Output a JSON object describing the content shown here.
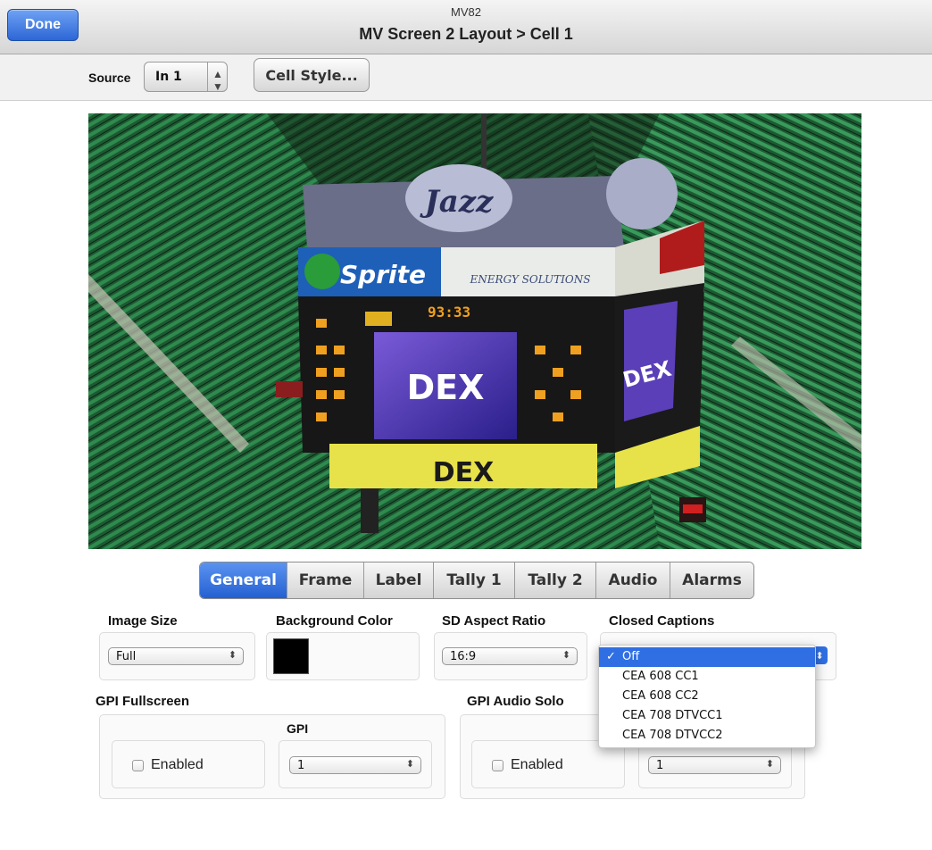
{
  "titlebar": {
    "done_label": "Done",
    "device": "MV82",
    "title": "MV Screen 2 Layout > Cell 1"
  },
  "sourcebar": {
    "source_label": "Source",
    "source_value": "In 1",
    "cell_style_label": "Cell Style..."
  },
  "preview": {
    "description_icon": "scoreboard-image",
    "signs": {
      "team": "Jazz",
      "sponsor": "Sprite",
      "sponsor2": "ENERGY SOLUTIONS",
      "screen": "DEX",
      "banner": "DEX",
      "side_screen": "DEX",
      "clock": "93:33"
    }
  },
  "tabs": [
    "General",
    "Frame",
    "Label",
    "Tally 1",
    "Tally 2",
    "Audio",
    "Alarms"
  ],
  "active_tab": "General",
  "general": {
    "image_size_label": "Image Size",
    "image_size_value": "Full",
    "background_color_label": "Background Color",
    "background_color": "#000000",
    "sd_aspect_label": "SD Aspect Ratio",
    "sd_aspect_value": "16:9",
    "closed_captions_label": "Closed Captions",
    "gpi_fullscreen_label": "GPI Fullscreen",
    "gpi_col_label": "GPI",
    "gpi_fullscreen_enabled_label": "Enabled",
    "gpi_fullscreen_value": "1",
    "gpi_audio_solo_label": "GPI Audio Solo",
    "gpi_audio_enabled_label": "Enabled",
    "gpi_audio_value": "1"
  },
  "captions_menu": {
    "checkmark": "✓",
    "items": [
      "Off",
      "CEA 608 CC1",
      "CEA 608 CC2",
      "CEA 708 DTVCC1",
      "CEA 708 DTVCC2"
    ],
    "selected": "Off"
  },
  "colors": {
    "accent": "#2f6fe3",
    "seats": "#1f6b3a"
  }
}
